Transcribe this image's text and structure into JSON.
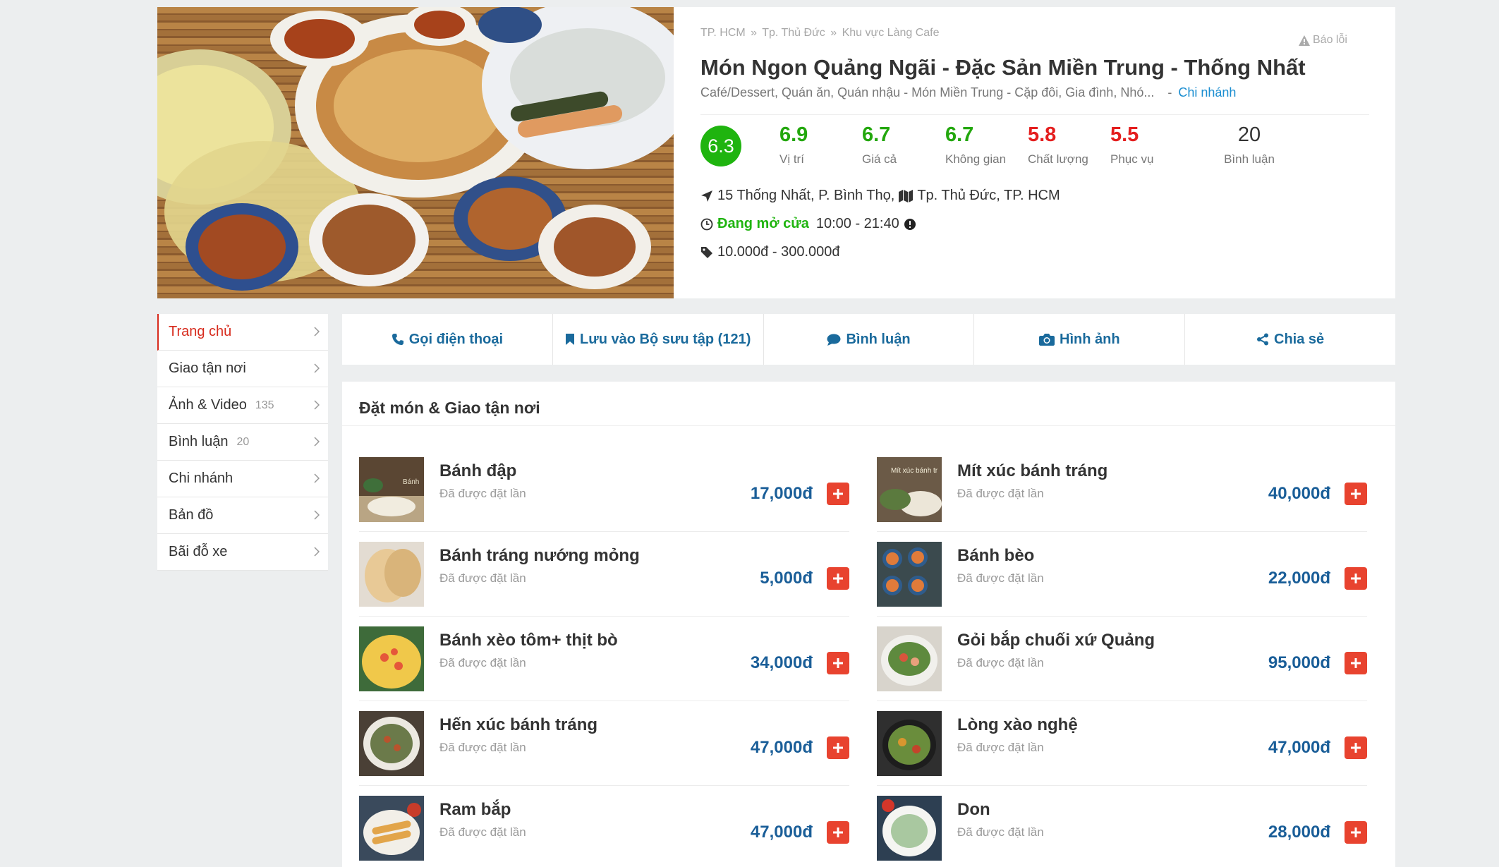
{
  "breadcrumb": [
    "TP. HCM",
    "Tp. Thủ Đức",
    "Khu vực Làng Cafe"
  ],
  "breadcrumb_sep": "»",
  "report_label": "Báo lỗi",
  "title": "Món Ngon Quảng Ngãi - Đặc Sản Miền Trung - Thống Nhất",
  "categories": "Café/Dessert, Quán ăn, Quán nhậu  -  Món Miền Trung  - Cặp đôi, Gia đình, Nhó...",
  "branch_dash": "-",
  "branch_link": "Chi nhánh",
  "score": "6.3",
  "ratings": [
    {
      "value": "6.9",
      "label": "Vị trí",
      "tone": "green"
    },
    {
      "value": "6.7",
      "label": "Giá cả",
      "tone": "green"
    },
    {
      "value": "6.7",
      "label": "Không gian",
      "tone": "green"
    },
    {
      "value": "5.8",
      "label": "Chất lượng",
      "tone": "red"
    },
    {
      "value": "5.5",
      "label": "Phục vụ",
      "tone": "red"
    }
  ],
  "review_count": {
    "value": "20",
    "label": "Bình luận"
  },
  "address": {
    "street": "15 Thống Nhất, P. Bình Thọ,",
    "city": "Tp. Thủ Đức, TP. HCM"
  },
  "hours": {
    "status": "Đang mở cửa",
    "time": "10:00 - 21:40"
  },
  "price_range": "10.000đ - 300.000đ",
  "nav": [
    {
      "label": "Trang chủ",
      "count": "",
      "active": true
    },
    {
      "label": "Giao tận nơi",
      "count": ""
    },
    {
      "label": "Ảnh & Video",
      "count": "135"
    },
    {
      "label": "Bình luận",
      "count": "20"
    },
    {
      "label": "Chi nhánh",
      "count": ""
    },
    {
      "label": "Bản đồ",
      "count": ""
    },
    {
      "label": "Bãi đỗ xe",
      "count": ""
    }
  ],
  "actions": [
    {
      "label": "Gọi điện thoại",
      "icon": "phone-icon"
    },
    {
      "label": "Lưu vào Bộ sưu tập (121)",
      "icon": "bookmark-icon"
    },
    {
      "label": "Bình luận",
      "icon": "comment-icon"
    },
    {
      "label": "Hình ảnh",
      "icon": "camera-icon"
    },
    {
      "label": "Chia sẻ",
      "icon": "share-icon"
    }
  ],
  "menu": {
    "title": "Đặt món & Giao tận nơi",
    "order_note": "Đã được đặt lần",
    "items": [
      {
        "name": "Bánh đập",
        "price": "17,000đ",
        "thumb_text": "Bánh"
      },
      {
        "name": "Mít xúc bánh tráng",
        "price": "40,000đ",
        "thumb_text": "Mít xúc bánh tr"
      },
      {
        "name": "Bánh tráng nướng mỏng",
        "price": "5,000đ",
        "thumb_text": ""
      },
      {
        "name": "Bánh bèo",
        "price": "22,000đ",
        "thumb_text": ""
      },
      {
        "name": "Bánh xèo tôm+ thịt bò",
        "price": "34,000đ",
        "thumb_text": ""
      },
      {
        "name": "Gỏi bắp chuối xứ Quảng",
        "price": "95,000đ",
        "thumb_text": ""
      },
      {
        "name": "Hến xúc bánh tráng",
        "price": "47,000đ",
        "thumb_text": ""
      },
      {
        "name": "Lòng xào nghệ",
        "price": "47,000đ",
        "thumb_text": ""
      },
      {
        "name": "Ram bắp",
        "price": "47,000đ",
        "thumb_text": ""
      },
      {
        "name": "Don",
        "price": "28,000đ",
        "thumb_text": ""
      }
    ]
  },
  "colors": {
    "accent_red": "#d72b1d",
    "score_green": "#1fb40f",
    "link_blue": "#1a6a9c",
    "price_blue": "#1a5e98",
    "add_red": "#e8432f"
  }
}
